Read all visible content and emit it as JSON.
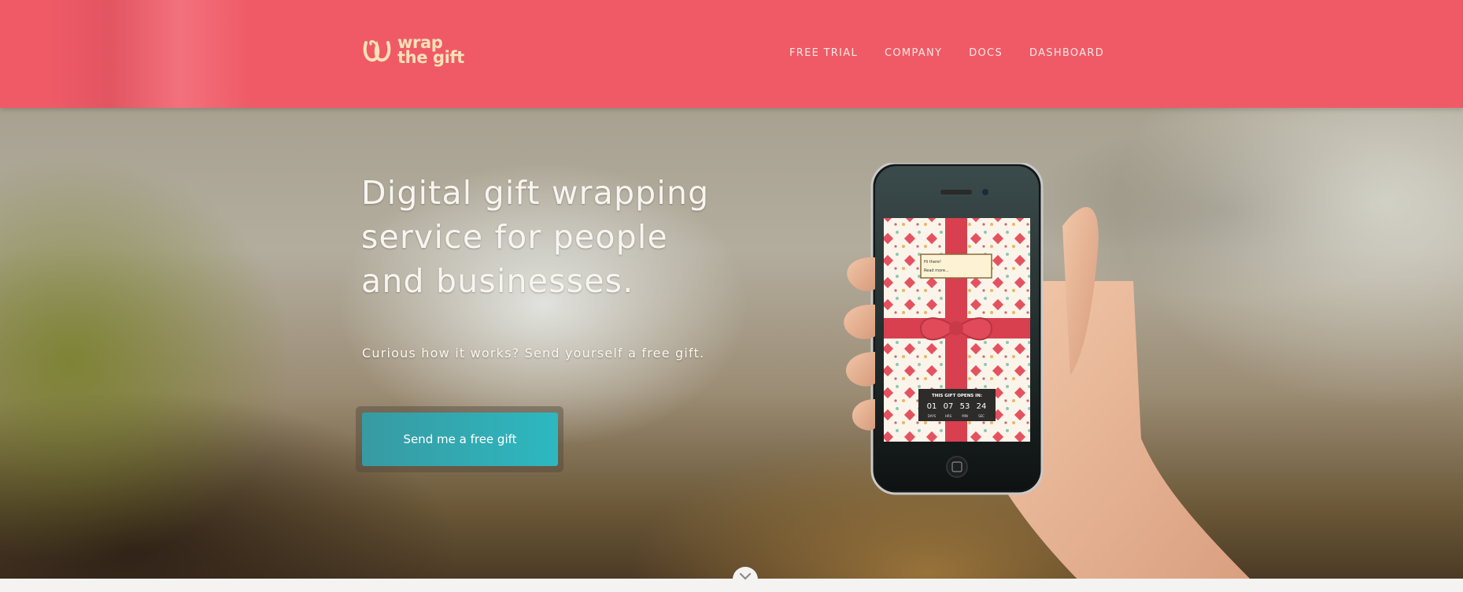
{
  "header": {
    "logo_line1": "wrap",
    "logo_line2": "the gift",
    "nav": [
      "FREE TRIAL",
      "COMPANY",
      "DOCS",
      "DASHBOARD"
    ]
  },
  "hero": {
    "title": "Digital gift wrapping service for people and businesses.",
    "subtitle": "Curious how it works? Send yourself a free gift.",
    "cta_label": "Send me a free gift"
  },
  "phone": {
    "note_line1": "Hi there!",
    "note_line2": "Read more...",
    "countdown_title": "THIS GIFT OPENS IN:",
    "countdown": [
      {
        "value": "01",
        "unit": "DAYS"
      },
      {
        "value": "07",
        "unit": "HRS"
      },
      {
        "value": "53",
        "unit": "MIN"
      },
      {
        "value": "24",
        "unit": "SEC"
      }
    ]
  },
  "icons": {
    "logo": "wrap-logo-icon",
    "scroll": "chevron-down-icon"
  },
  "colors": {
    "header": "#f05a67",
    "logo": "#f9e2b6",
    "button": "#2db8c0",
    "ribbon": "#d8404f"
  }
}
